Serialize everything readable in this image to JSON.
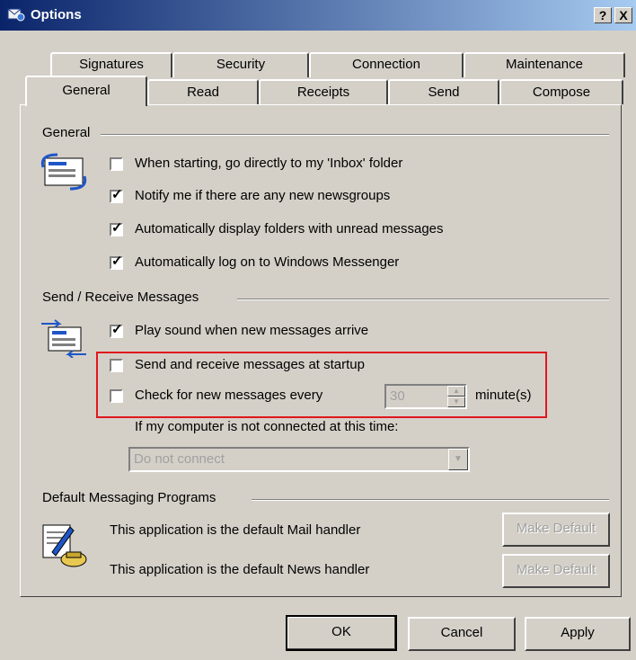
{
  "window": {
    "title": "Options",
    "help_label": "?",
    "close_label": "X"
  },
  "tabs_row1": [
    {
      "label": "Signatures"
    },
    {
      "label": "Security"
    },
    {
      "label": "Connection"
    },
    {
      "label": "Maintenance"
    }
  ],
  "tabs_row2": [
    {
      "label": "General"
    },
    {
      "label": "Read"
    },
    {
      "label": "Receipts"
    },
    {
      "label": "Send"
    },
    {
      "label": "Compose"
    }
  ],
  "general": {
    "heading": "General",
    "options": [
      {
        "label": "When starting, go directly to my 'Inbox' folder",
        "checked": false
      },
      {
        "label": "Notify me if there are any new newsgroups",
        "checked": true
      },
      {
        "label": "Automatically display folders with unread messages",
        "checked": true
      },
      {
        "label": "Automatically log on to Windows Messenger",
        "checked": true
      }
    ]
  },
  "send_receive": {
    "heading": "Send / Receive Messages",
    "play_sound": {
      "label": "Play sound when new messages arrive",
      "checked": true
    },
    "startup": {
      "label": "Send and receive messages at startup",
      "checked": false
    },
    "check_every": {
      "label": "Check for new messages every",
      "checked": false,
      "value": "30",
      "unit": "minute(s)"
    },
    "not_connected_label": "If my computer is not connected at this time:",
    "not_connected_value": "Do not connect"
  },
  "default_programs": {
    "heading": "Default Messaging Programs",
    "mail_text": "This application is the default Mail handler",
    "news_text": "This application is the default News handler",
    "make_default_label": "Make Default"
  },
  "footer": {
    "ok_label": "OK",
    "cancel_label": "Cancel",
    "apply_label": "Apply"
  },
  "colors": {
    "highlight_box": "#e0161e",
    "titlebar_start": "#0a246a",
    "titlebar_end": "#a6caf0"
  }
}
